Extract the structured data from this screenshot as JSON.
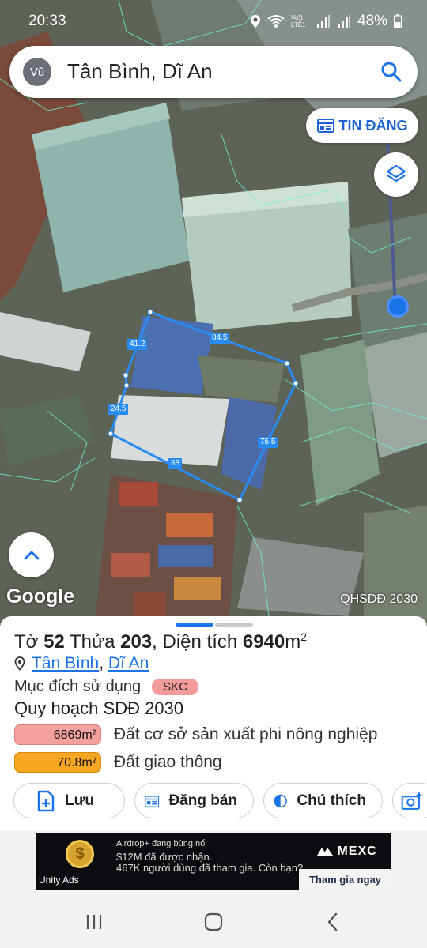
{
  "status_bar": {
    "time": "20:33",
    "battery": "48%",
    "network_label": "Vo)) LTE1"
  },
  "search": {
    "avatar_initials": "Vũ",
    "query": "Tân Bình, Dĩ An"
  },
  "map": {
    "tin_dang_label": "TIN ĐĂNG",
    "provider_logo": "Google",
    "layer_label": "QHSDĐ 2030",
    "edge_lengths": [
      "41.2",
      "84.5",
      "24.5",
      "75.5",
      "88"
    ],
    "parcel_outline_color": "#2a8bf2"
  },
  "parcel": {
    "to_label": "Tờ",
    "to_value": "52",
    "thua_label": "Thửa",
    "thua_value": "203",
    "area_label": "Diện tích",
    "area_value": "6940",
    "area_unit": "m",
    "area_sup": "2",
    "ward": "Tân Bình",
    "district": "Dĩ An",
    "separator": ",",
    "purpose_label": "Mục đích sử dụng",
    "purpose_code": "SKC",
    "plan_title": "Quy hoạch SDĐ 2030",
    "plan_items": [
      {
        "area": "6869m²",
        "label": "Đất cơ sở sản xuất phi nông nghiệp",
        "color": "#f4a09c"
      },
      {
        "area": "70.8m²",
        "label": "Đất giao thông",
        "color": "#f6a623"
      }
    ]
  },
  "actions": {
    "save": "Lưu",
    "post_sale": "Đăng bán",
    "legend": "Chú thích"
  },
  "ad": {
    "line1": "Airdrop+ đang bùng nổ",
    "line2": "$12M đã được nhận.",
    "line3": "467K người dùng đã tham gia. Còn bạn?",
    "brand": "MEXC",
    "cta": "Tham gia ngay",
    "network": "Unity Ads"
  },
  "colors": {
    "accent": "#1a73e8",
    "skc_badge": "#f39a9a"
  }
}
